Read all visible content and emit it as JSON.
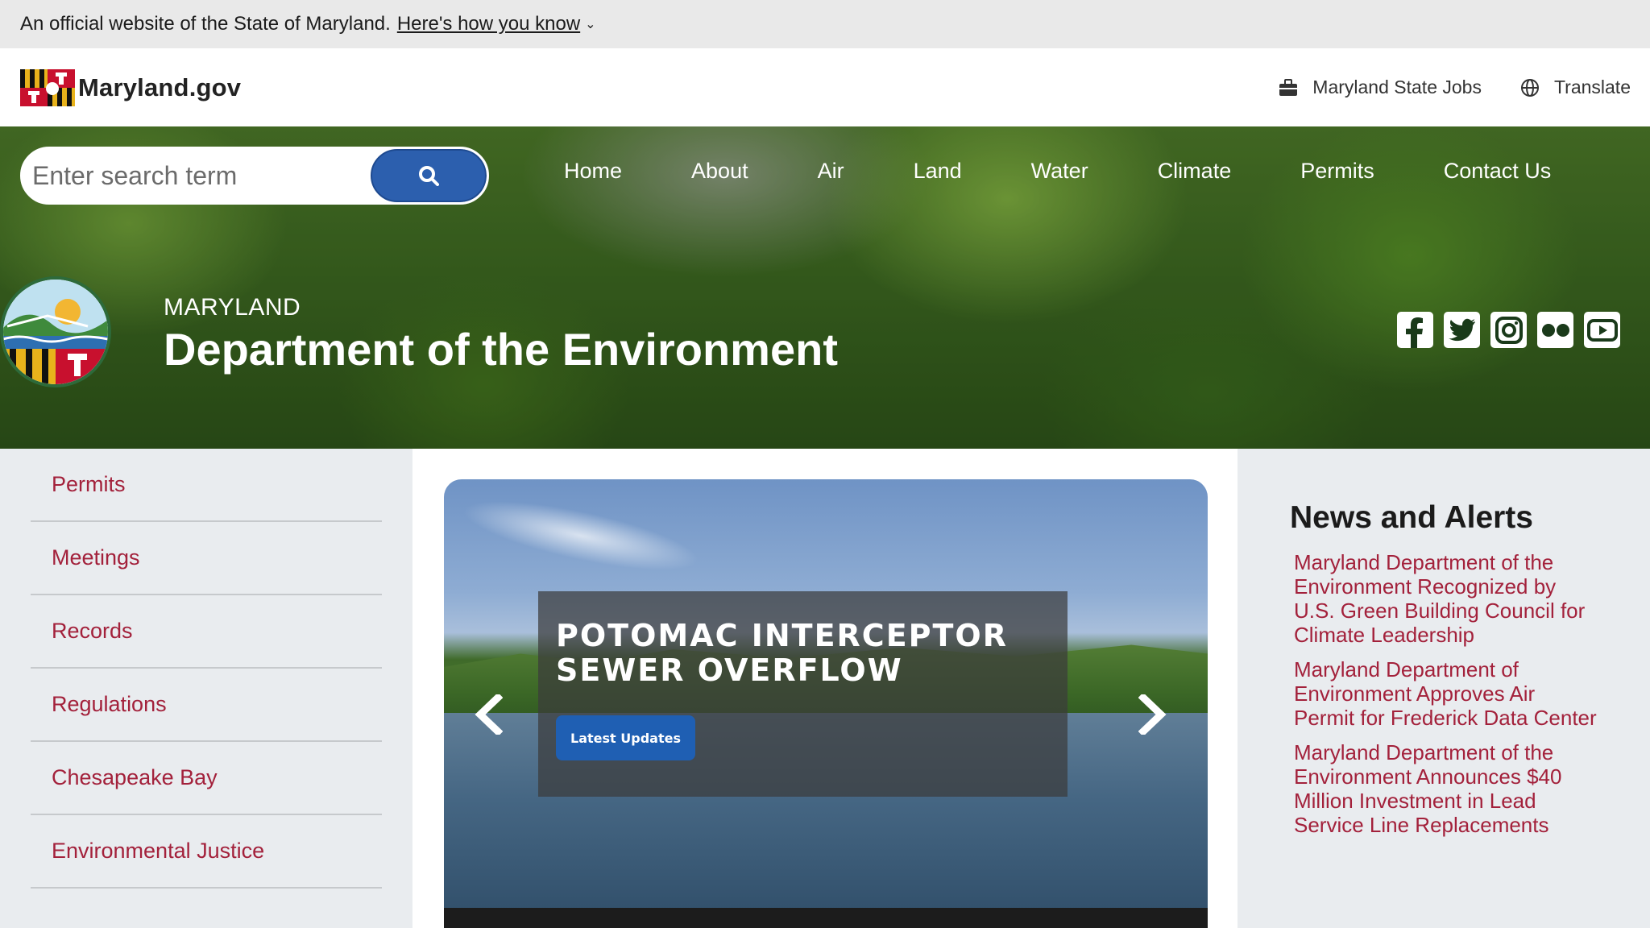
{
  "gov_banner": {
    "text": "An official website of the State of Maryland.",
    "link": "Here's how you know",
    "chevron": "⌄"
  },
  "header": {
    "brand": "Maryland.gov",
    "links": [
      {
        "label": "Maryland State Jobs",
        "icon": "briefcase-icon"
      },
      {
        "label": "Translate",
        "icon": "globe-icon"
      }
    ]
  },
  "search": {
    "placeholder": "Enter search term"
  },
  "nav": {
    "items": [
      "Home",
      "About",
      "Air",
      "Land",
      "Water",
      "Climate",
      "Permits",
      "Contact Us"
    ]
  },
  "agency": {
    "kicker": "MARYLAND",
    "title": "Department of the Environment"
  },
  "social": [
    "facebook-icon",
    "twitter-icon",
    "instagram-icon",
    "flickr-icon",
    "youtube-icon"
  ],
  "sidebar": {
    "items": [
      "Permits",
      "Meetings",
      "Records",
      "Regulations",
      "Chesapeake Bay",
      "Environmental Justice"
    ]
  },
  "carousel": {
    "title": "POTOMAC INTERCEPTOR SEWER OVERFLOW",
    "button": "Latest Updates"
  },
  "news": {
    "heading": "News and Alerts",
    "items": [
      "Maryland Department of the Environment Recognized by U.S. Green Building Council for Climate Leadership",
      "Maryland Department of Environment Approves Air Permit for Frederick Data Center",
      "Maryland Department of the Environment Announces $40 Million Investment in Lead Service Line Replacements"
    ]
  },
  "colors": {
    "accent_blue": "#2c5fae",
    "link_red": "#a3213b",
    "panel_gray": "#e9ecef"
  }
}
